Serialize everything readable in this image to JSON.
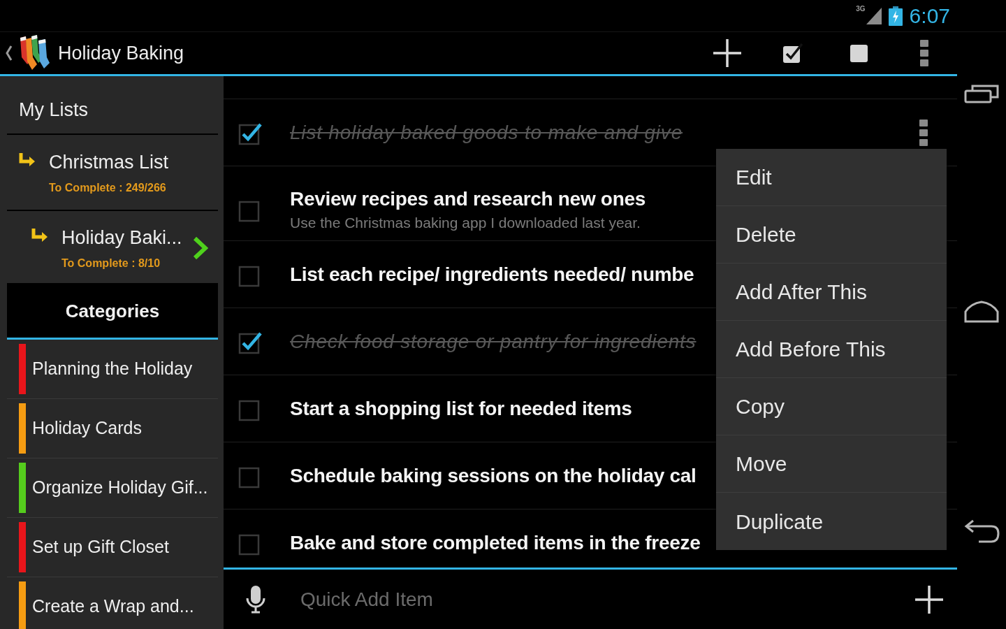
{
  "status_bar": {
    "network": "3G",
    "time": "6:07"
  },
  "action_bar": {
    "title": "Holiday Baking"
  },
  "sidebar": {
    "header": "My Lists",
    "lists": [
      {
        "name": "Christmas List",
        "progress": "To Complete : 249/266",
        "selected": false,
        "children": [
          {
            "name": "Holiday Baki...",
            "progress": "To Complete : 8/10",
            "selected": true
          }
        ]
      }
    ],
    "categories_tab": "Categories",
    "categories": [
      {
        "name": "Planning the Holiday",
        "color": "#e8151b"
      },
      {
        "name": "Holiday Cards",
        "color": "#f59c12"
      },
      {
        "name": "Organize Holiday Gif...",
        "color": "#55cc1d"
      },
      {
        "name": "Set up Gift Closet",
        "color": "#e8151b"
      },
      {
        "name": "Create a Wrap and...",
        "color": "#f59c12"
      }
    ]
  },
  "tasks": [
    {
      "title": "List holiday baked goods to make and give",
      "checked": true,
      "menu_open": true
    },
    {
      "title": "Review recipes and research new ones",
      "note": "Use the Christmas baking app I downloaded last year.",
      "checked": false,
      "menu_open": false
    },
    {
      "title": "List each recipe/ ingredients needed/ numbe",
      "checked": false,
      "menu_open": false
    },
    {
      "title": "Check food storage or pantry for ingredients",
      "checked": true,
      "menu_open": false
    },
    {
      "title": "Start a shopping list for needed items",
      "checked": false,
      "menu_open": false
    },
    {
      "title": "Schedule baking sessions on the holiday cal",
      "checked": false,
      "menu_open": false
    },
    {
      "title": "Bake and store completed items in the freeze",
      "checked": false,
      "menu_open": false
    }
  ],
  "context_menu": {
    "items": [
      "Edit",
      "Delete",
      "Add After This",
      "Add Before This",
      "Copy",
      "Move",
      "Duplicate"
    ]
  },
  "quick_add": {
    "placeholder": "Quick Add Item"
  }
}
